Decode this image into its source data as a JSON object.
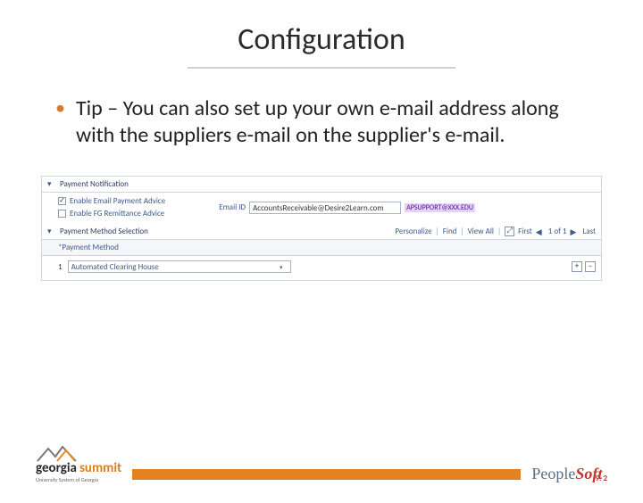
{
  "title": "Configuration",
  "bullet": "Tip – You can also set up your own e-mail address along with the suppliers e-mail on the supplier's e-mail.",
  "payment_notification": {
    "section_title": "Payment Notification",
    "enable_email_label": "Enable Email Payment Advice",
    "enable_email_checked": true,
    "enable_fg_label": "Enable FG Remittance Advice",
    "enable_fg_checked": false,
    "email_label": "Email ID",
    "email_value": "AccountsReceivable@Desire2Learn.com",
    "email_highlight": "APSUPPORT@XXX.EDU"
  },
  "payment_method": {
    "section_title": "Payment Method Selection",
    "toolbar": {
      "personalize": "Personalize",
      "find": "Find",
      "view_all": "View All",
      "first": "First",
      "pager": "1 of 1",
      "last": "Last"
    },
    "col_header": "*Payment Method",
    "row_num": "1",
    "method_value": "Automated Clearing House"
  },
  "footer": {
    "georgia": "georgia",
    "summit": "summit",
    "subtitle": "University System of Georgia",
    "ps_people": "People",
    "ps_soft": "Soft",
    "ps_version": "9. 2"
  }
}
